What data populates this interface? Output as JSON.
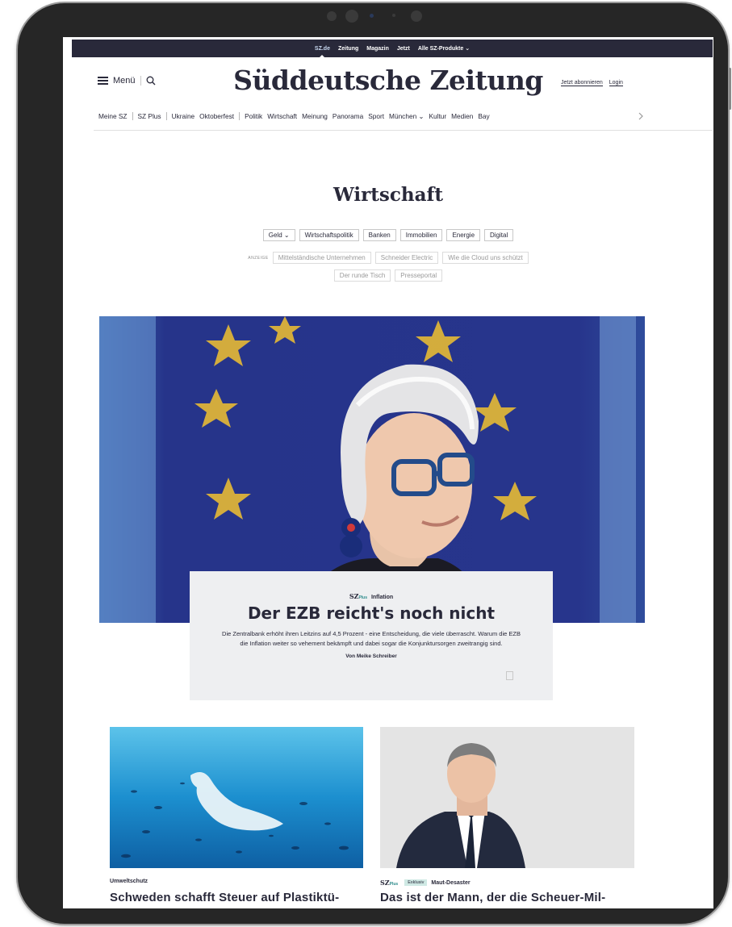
{
  "topbar": {
    "items": [
      "SZ.de",
      "Zeitung",
      "Magazin",
      "Jetzt",
      "Alle SZ-Produkte"
    ]
  },
  "header": {
    "menu_label": "Menü",
    "logo": "Süddeutsche Zeitung",
    "subscribe": "Jetzt abonnieren",
    "login": "Login"
  },
  "nav": {
    "items": [
      "Meine SZ",
      "SZ Plus",
      "Ukraine",
      "Oktoberfest",
      "Politik",
      "Wirtschaft",
      "Meinung",
      "Panorama",
      "Sport",
      "München",
      "Kultur",
      "Medien",
      "Bay"
    ]
  },
  "section": {
    "title": "Wirtschaft",
    "chips": [
      "Geld",
      "Wirtschaftspolitik",
      "Banken",
      "Immobilien",
      "Energie",
      "Digital"
    ],
    "ad_label": "ANZEIGE",
    "ad_chips": [
      "Mittelständische Unternehmen",
      "Schneider Electric",
      "Wie die Cloud uns schützt",
      "Der runde Tisch",
      "Presseportal"
    ]
  },
  "hero": {
    "brand": "SZ",
    "brand_plus": "Plus",
    "kicker": "Inflation",
    "headline": "Der EZB reicht's noch nicht",
    "text": "Die Zentralbank erhöht ihren Leitzins auf 4,5 Prozent - eine Entscheidung, die viele überrascht. Warum die EZB die Inflation weiter so vehement bekämpft und dabei sogar die Konjunktursorgen zweitrangig sind.",
    "author": "Von Meike Schreiber"
  },
  "cards": [
    {
      "kicker": "Umweltschutz",
      "title": "Schweden schafft Steuer auf Plastiktü-"
    },
    {
      "brand": "SZ",
      "brand_plus": "Plus",
      "badge": "Exklusiv",
      "kicker": "Maut-Desaster",
      "title": "Das ist der Mann, der die Scheuer-Mil-"
    }
  ],
  "colors": {
    "ink": "#29293a",
    "teal": "#2a8a8a",
    "eu_blue": "#2b3a8f",
    "star": "#f2c230"
  }
}
